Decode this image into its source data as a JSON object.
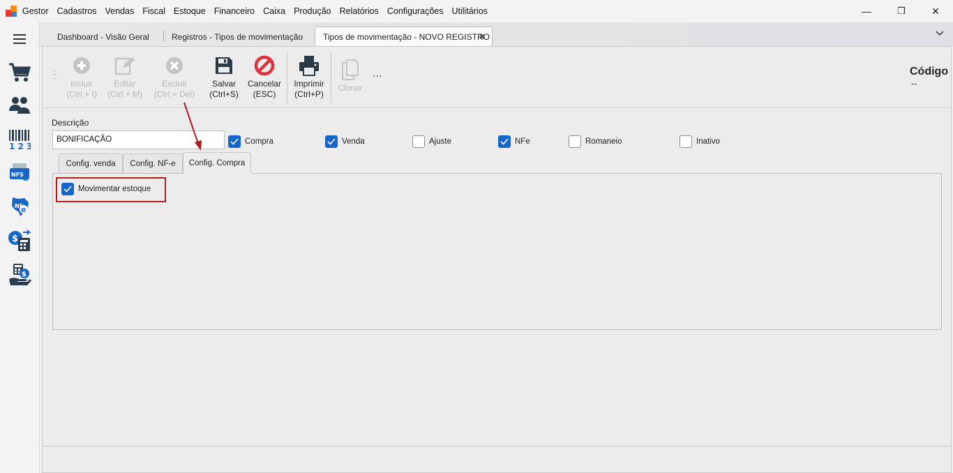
{
  "app": {
    "name": "Gestor"
  },
  "menu": [
    "Cadastros",
    "Vendas",
    "Fiscal",
    "Estoque",
    "Financeiro",
    "Caixa",
    "Produção",
    "Relatórios",
    "Configurações",
    "Utilitários"
  ],
  "window_controls": {
    "minimize": "—",
    "restore": "❐",
    "close": "✕"
  },
  "tabs": [
    {
      "label": "Dashboard - Visão Geral"
    },
    {
      "label": "Registros - Tipos de movimentação"
    },
    {
      "label": "Tipos de movimentação - NOVO REGISTRO",
      "close": "✕"
    }
  ],
  "toolbar": {
    "incluir": {
      "line1": "Incluir",
      "line2": "(Ctrl + I)"
    },
    "editar": {
      "line1": "Editar",
      "line2": "(Ctrl + M)"
    },
    "excluir": {
      "line1": "Excluir",
      "line2": "(Ctrl + Del)"
    },
    "salvar": {
      "line1": "Salvar",
      "line2": "(Ctrl+S)"
    },
    "cancelar": {
      "line1": "Cancelar",
      "line2": "(ESC)"
    },
    "imprimir": {
      "line1": "Imprimir",
      "line2": "(Ctrl+P)"
    },
    "clonar": {
      "line1": "Clonar"
    },
    "more": "..."
  },
  "codigo": {
    "label": "Código",
    "value": "--"
  },
  "form": {
    "descricao_label": "Descrição",
    "descricao_value": "BONIFICAÇÃO",
    "checkboxes": [
      {
        "label": "Compra",
        "checked": true
      },
      {
        "label": "Venda",
        "checked": true
      },
      {
        "label": "Ajuste",
        "checked": false
      },
      {
        "label": "NFe",
        "checked": true
      },
      {
        "label": "Romaneio",
        "checked": false
      },
      {
        "label": "Inativo",
        "checked": false
      }
    ]
  },
  "subtabs": [
    {
      "label": "Config. venda"
    },
    {
      "label": "Config. NF-e"
    },
    {
      "label": "Config. Compra",
      "active": true
    }
  ],
  "config_compra": {
    "movimentar_estoque": {
      "label": "Movimentar estoque",
      "checked": true
    }
  },
  "colors": {
    "accent": "#1466c8",
    "annotation": "#b01c1c",
    "cancel": "#e0313b"
  }
}
